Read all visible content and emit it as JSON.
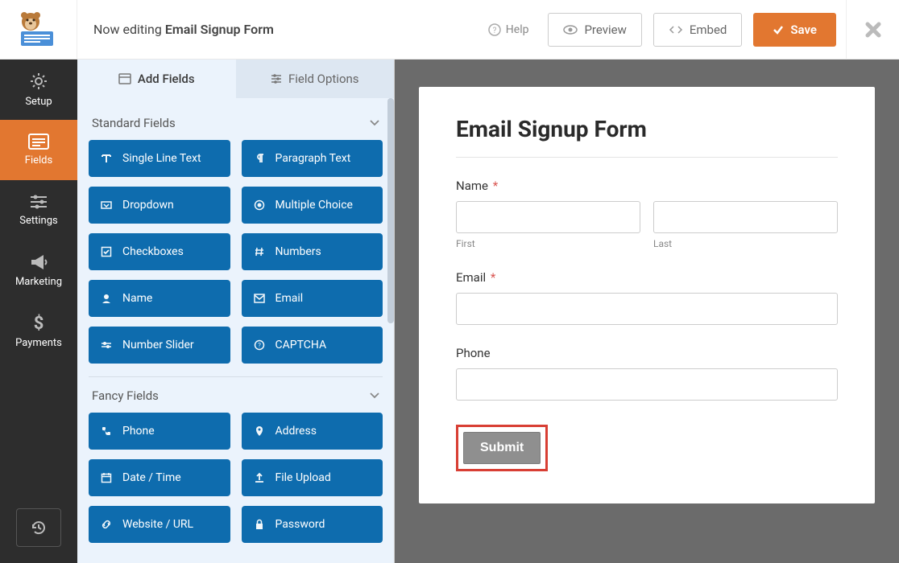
{
  "header": {
    "editing_prefix": "Now editing ",
    "form_name": "Email Signup Form",
    "help": "Help",
    "preview": "Preview",
    "embed": "Embed",
    "save": "Save"
  },
  "leftnav": {
    "setup": "Setup",
    "fields": "Fields",
    "settings": "Settings",
    "marketing": "Marketing",
    "payments": "Payments"
  },
  "panel": {
    "tab_add": "Add Fields",
    "tab_options": "Field Options",
    "sections": {
      "standard": {
        "title": "Standard Fields",
        "items": [
          {
            "label": "Single Line Text",
            "icon": "text"
          },
          {
            "label": "Paragraph Text",
            "icon": "paragraph"
          },
          {
            "label": "Dropdown",
            "icon": "dropdown"
          },
          {
            "label": "Multiple Choice",
            "icon": "radio"
          },
          {
            "label": "Checkboxes",
            "icon": "check"
          },
          {
            "label": "Numbers",
            "icon": "hash"
          },
          {
            "label": "Name",
            "icon": "user"
          },
          {
            "label": "Email",
            "icon": "mail"
          },
          {
            "label": "Number Slider",
            "icon": "slider"
          },
          {
            "label": "CAPTCHA",
            "icon": "help"
          }
        ]
      },
      "fancy": {
        "title": "Fancy Fields",
        "items": [
          {
            "label": "Phone",
            "icon": "phone"
          },
          {
            "label": "Address",
            "icon": "pin"
          },
          {
            "label": "Date / Time",
            "icon": "calendar"
          },
          {
            "label": "File Upload",
            "icon": "upload"
          },
          {
            "label": "Website / URL",
            "icon": "link"
          },
          {
            "label": "Password",
            "icon": "lock"
          }
        ]
      }
    }
  },
  "form": {
    "title": "Email Signup Form",
    "name_label": "Name",
    "first_sub": "First",
    "last_sub": "Last",
    "email_label": "Email",
    "phone_label": "Phone",
    "submit": "Submit"
  }
}
